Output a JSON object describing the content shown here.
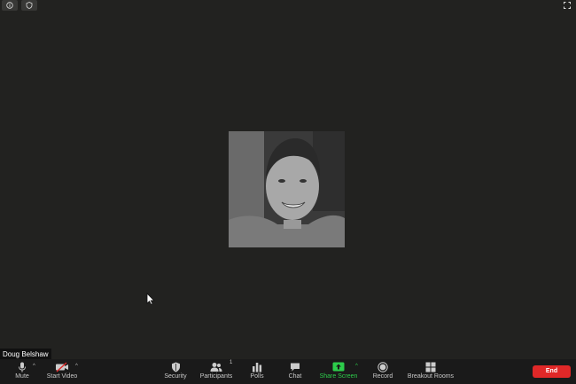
{
  "presenter": {
    "name": "Doug Belshaw"
  },
  "toolbar": {
    "mute": "Mute",
    "start_video": "Start Video",
    "security": "Security",
    "participants": "Participants",
    "participants_count": "1",
    "polls": "Polls",
    "chat": "Chat",
    "share_screen": "Share Screen",
    "record": "Record",
    "breakout_rooms": "Breakout Rooms",
    "end": "End"
  },
  "colors": {
    "background": "#222220",
    "toolbar": "#1a1a1a",
    "share_green": "#2dcc4b",
    "end_red": "#e02828"
  },
  "icons": [
    "info-icon",
    "shield-icon",
    "expand-icon",
    "microphone-icon",
    "video-off-icon",
    "security-shield-icon",
    "participants-icon",
    "polls-icon",
    "chat-icon",
    "share-screen-icon",
    "record-icon",
    "breakout-rooms-icon",
    "cursor-icon"
  ]
}
